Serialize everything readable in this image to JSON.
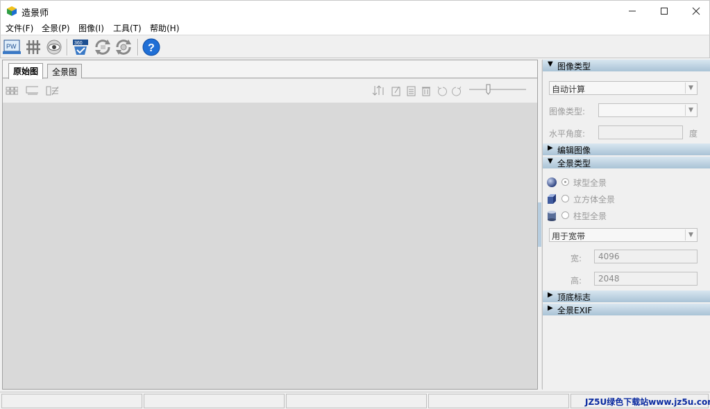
{
  "window": {
    "title": "造景师"
  },
  "menu": [
    "文件(F)",
    "全景(P)",
    "图像(I)",
    "工具(T)",
    "帮助(H)"
  ],
  "toolbar": {
    "pw_label": "PW",
    "icons": [
      "ptgui-icon",
      "grid-icon",
      "eye-icon",
      "vr360-icon",
      "sync-icon",
      "settings-sync-icon",
      "help-icon"
    ]
  },
  "tabs": [
    "原始图",
    "全景图"
  ],
  "right": {
    "image_type": {
      "header": "图像类型",
      "mode_value": "自动计算",
      "type_label": "图像类型:",
      "type_value": "",
      "angle_label": "水平角度:",
      "angle_value": "",
      "angle_unit": "度"
    },
    "edit_image": {
      "header": "编辑图像"
    },
    "pano_type": {
      "header": "全景类型",
      "options": [
        "球型全景",
        "立方体全景",
        "柱型全景"
      ],
      "selected_index": 0,
      "usage_value": "用于宽带",
      "width_label": "宽:",
      "width_value": "4096",
      "height_label": "高:",
      "height_value": "2048"
    },
    "top_bottom": {
      "header": "顶底标志"
    },
    "exif": {
      "header": "全景EXIF"
    }
  },
  "status": {
    "watermark": "JZ5U绿色下载站www.jz5u.com"
  },
  "colors": {
    "section_header_top": "#d8e6f0",
    "section_header_bottom": "#a9c3d6",
    "canvas_bg": "#d9d9d9",
    "watermark": "#0a2aa0"
  }
}
